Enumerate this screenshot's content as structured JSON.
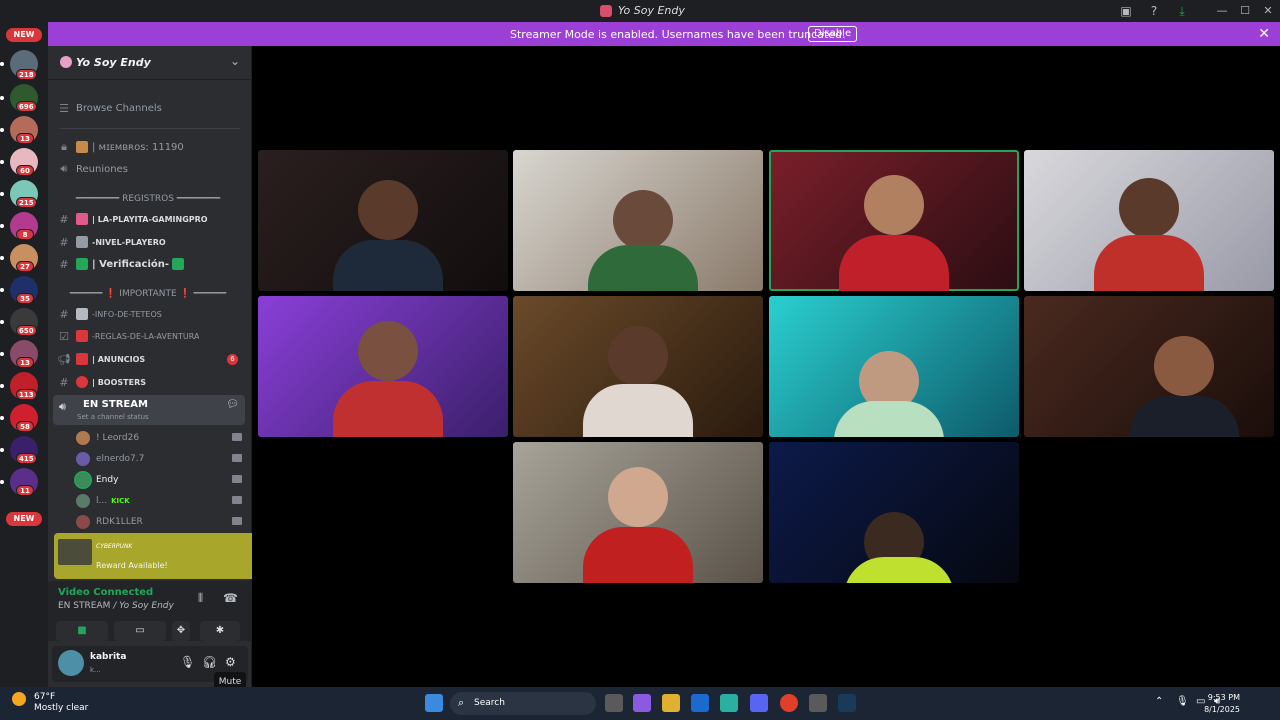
{
  "window": {
    "title": "Yo Soy Endy"
  },
  "banner": {
    "message": "Streamer Mode is enabled. Usernames have been truncated.",
    "disable_label": "Disable"
  },
  "rail": {
    "new_top": "NEW",
    "new_bottom": "NEW",
    "badges": [
      "218",
      "696",
      "13",
      "60",
      "215",
      "8",
      "27",
      "35",
      "650",
      "13",
      "113",
      "58",
      "415",
      "11"
    ]
  },
  "server": {
    "name": "Yo Soy Endy"
  },
  "sidebar": {
    "browse": "Browse Channels",
    "members": "| ᴍɪᴇᴍʙʀᴏs: 11190",
    "meetings": "Reuniones",
    "cat_registros": "━━━━━━━━ REGISTROS ━━━━━━━━",
    "ch1": "| LA-PLAYITA-GAMINGPRO",
    "ch2": "-NIVEL-PLAYERO",
    "ch3": "| Verificación-",
    "cat_importante": "━━━━━━ ❗ IMPORTANTE ❗ ━━━━━━",
    "ch4": "-INFO-DE-TETEOS",
    "ch5": "-REGLAS-DE-LA-AVENTURA",
    "ch6": "| ANUNCIOS",
    "ch6_count": "6",
    "ch7": "| BOOSTERS",
    "active_channel": "EN STREAM",
    "active_status": "Set a channel status",
    "users": [
      {
        "name": "! Leord26"
      },
      {
        "name": "elnerdo7.7"
      },
      {
        "name": "Endy"
      },
      {
        "name": "l...",
        "tag": "KICK"
      },
      {
        "name": "RDK1LLER"
      }
    ]
  },
  "reward": {
    "brand": "CYBERPUNK",
    "text": "Reward Available!"
  },
  "voice": {
    "title": "Video Connected",
    "sub": "EN STREAM",
    "sub_server": "/ Yo Soy Endy"
  },
  "user_panel": {
    "name": "kabrita",
    "status": "k..."
  },
  "tooltip": {
    "text": "Mute"
  },
  "taskbar": {
    "temp": "67°F",
    "weather": "Mostly clear",
    "search": "Search",
    "time": "9:53 PM",
    "date": "8/1/2025"
  },
  "colors": {
    "accent": "#9b3fd6",
    "speaking": "#23a55a",
    "badge": "#da373c"
  }
}
